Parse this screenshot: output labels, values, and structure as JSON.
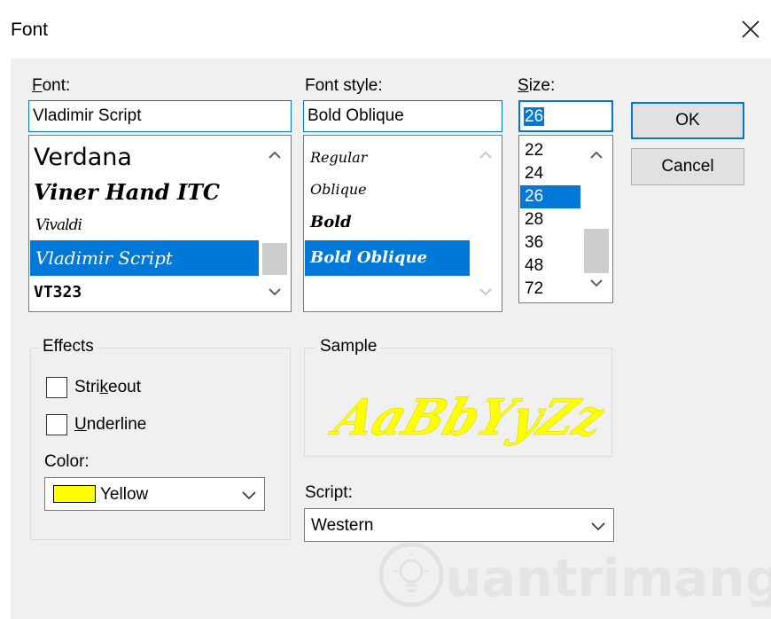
{
  "dialog": {
    "title": "Font",
    "close_glyph": "✕"
  },
  "font": {
    "label": "Font:",
    "value": "Vladimir Script",
    "items": [
      {
        "label": "Verdana",
        "selected": false
      },
      {
        "label": "Viner Hand ITC",
        "selected": false
      },
      {
        "label": "Vivaldi",
        "selected": false
      },
      {
        "label": "Vladimir Script",
        "selected": true
      },
      {
        "label": "VT323",
        "selected": false
      }
    ]
  },
  "font_style": {
    "label": "Font style:",
    "value": "Bold Oblique",
    "items": [
      {
        "label": "Regular",
        "selected": false
      },
      {
        "label": "Oblique",
        "selected": false
      },
      {
        "label": "Bold",
        "selected": false
      },
      {
        "label": "Bold Oblique",
        "selected": true
      }
    ]
  },
  "size": {
    "label": "Size:",
    "value": "26",
    "items": [
      {
        "label": "22",
        "selected": false
      },
      {
        "label": "24",
        "selected": false
      },
      {
        "label": "26",
        "selected": true
      },
      {
        "label": "28",
        "selected": false
      },
      {
        "label": "36",
        "selected": false
      },
      {
        "label": "48",
        "selected": false
      },
      {
        "label": "72",
        "selected": false
      }
    ]
  },
  "buttons": {
    "ok": "OK",
    "cancel": "Cancel"
  },
  "effects": {
    "title": "Effects",
    "strikeout": {
      "label": "Strikeout",
      "checked": false
    },
    "underline": {
      "label": "Underline",
      "checked": false
    },
    "color_label": "Color:",
    "color_value": "Yellow",
    "swatch": "#ffff00"
  },
  "sample": {
    "title": "Sample",
    "text": "AaBbYyZz",
    "color": "#ffff00"
  },
  "script": {
    "label": "Script:",
    "value": "Western"
  },
  "watermark": {
    "text": "uantrimang"
  },
  "colors": {
    "accent": "#0078d7",
    "dialog_bg": "#f0f0f0",
    "button_bg": "#e1e1e1",
    "scroll_thumb": "#cdcdcd"
  }
}
